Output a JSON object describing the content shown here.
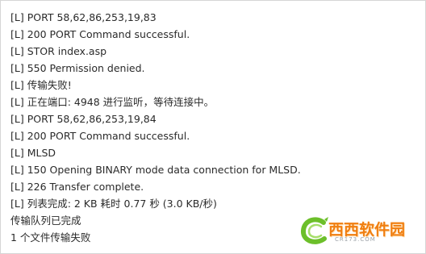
{
  "log_lines": [
    "[L] PORT 58,62,86,253,19,83",
    "[L] 200 PORT Command successful.",
    "[L] STOR index.asp",
    "[L] 550 Permission denied.",
    "[L] 传输失败!",
    "[L] 正在端口: 4948 进行监听，等待连接中。",
    "[L] PORT 58,62,86,253,19,84",
    "[L] 200 PORT Command successful.",
    "[L] MLSD",
    "[L] 150 Opening BINARY mode data connection for MLSD.",
    "[L] 226 Transfer complete.",
    "[L] 列表完成: 2 KB 耗时 0.77 秒 (3.0 KB/秒)",
    "传输队列已完成",
    "1 个文件传输失败"
  ],
  "watermark": {
    "text": "西西软件园",
    "domain": "CR173.COM"
  },
  "colors": {
    "text": "#2a2a2a",
    "border": "#d6d6d6",
    "watermark_orange": "#f07e10",
    "watermark_green": "#6cbf2a"
  }
}
